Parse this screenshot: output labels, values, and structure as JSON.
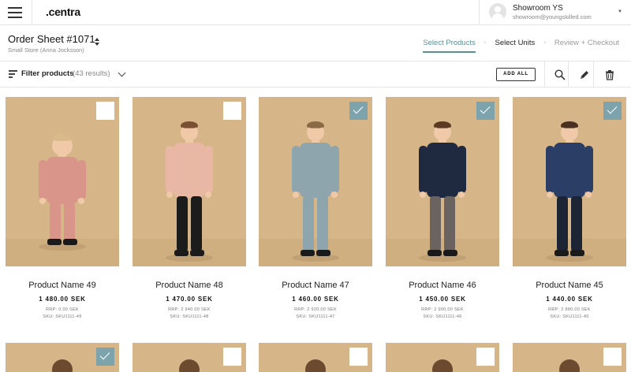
{
  "app": {
    "logo": ".centra",
    "user": {
      "name": "Showroom YS",
      "email": "showroom@youngskilled.com"
    }
  },
  "order": {
    "title": "Order Sheet #1071",
    "subtitle": "Small Store (Anna Jocksson)",
    "steps": [
      {
        "label": "Select Products",
        "state": "active"
      },
      {
        "label": "Select Units",
        "state": "next"
      },
      {
        "label": "Review + Checkout",
        "state": "later"
      }
    ]
  },
  "filter": {
    "label": "Filter products",
    "count": "(43 results)",
    "add_all": "ADD ALL",
    "tools": [
      "search-icon",
      "pencil-icon",
      "trash-icon"
    ]
  },
  "colors": {
    "accent": "#5a8f96",
    "checked": "#7da3ad",
    "photo_bg": "#d6b688"
  },
  "products": [
    {
      "name": "Product Name 49",
      "price": "1 480.00 SEK",
      "rrp": "RRP: 0.00 SEK",
      "sku": "SKU: SKU1111-49",
      "selected": false,
      "outfit": "pink-toddler"
    },
    {
      "name": "Product Name 48",
      "price": "1 470.00 SEK",
      "rrp": "RRP: 2 940.00 SEK",
      "sku": "SKU: SKU1111-48",
      "selected": false,
      "outfit": "pink-tee"
    },
    {
      "name": "Product Name 47",
      "price": "1 460.00 SEK",
      "rrp": "RRP: 2 920.00 SEK",
      "sku": "SKU: SKU1111-47",
      "selected": true,
      "outfit": "blue-jumpsuit"
    },
    {
      "name": "Product Name 46",
      "price": "1 450.00 SEK",
      "rrp": "RRP: 2 900.00 SEK",
      "sku": "SKU: SKU1111-46",
      "selected": true,
      "outfit": "navy-sweater"
    },
    {
      "name": "Product Name 45",
      "price": "1 440.00 SEK",
      "rrp": "RRP: 2 880.00 SEK",
      "sku": "SKU: SKU1111-45",
      "selected": true,
      "outfit": "blue-parka"
    }
  ],
  "next_row": [
    {
      "selected": true
    },
    {
      "selected": false
    },
    {
      "selected": false
    },
    {
      "selected": false
    },
    {
      "selected": false
    }
  ]
}
